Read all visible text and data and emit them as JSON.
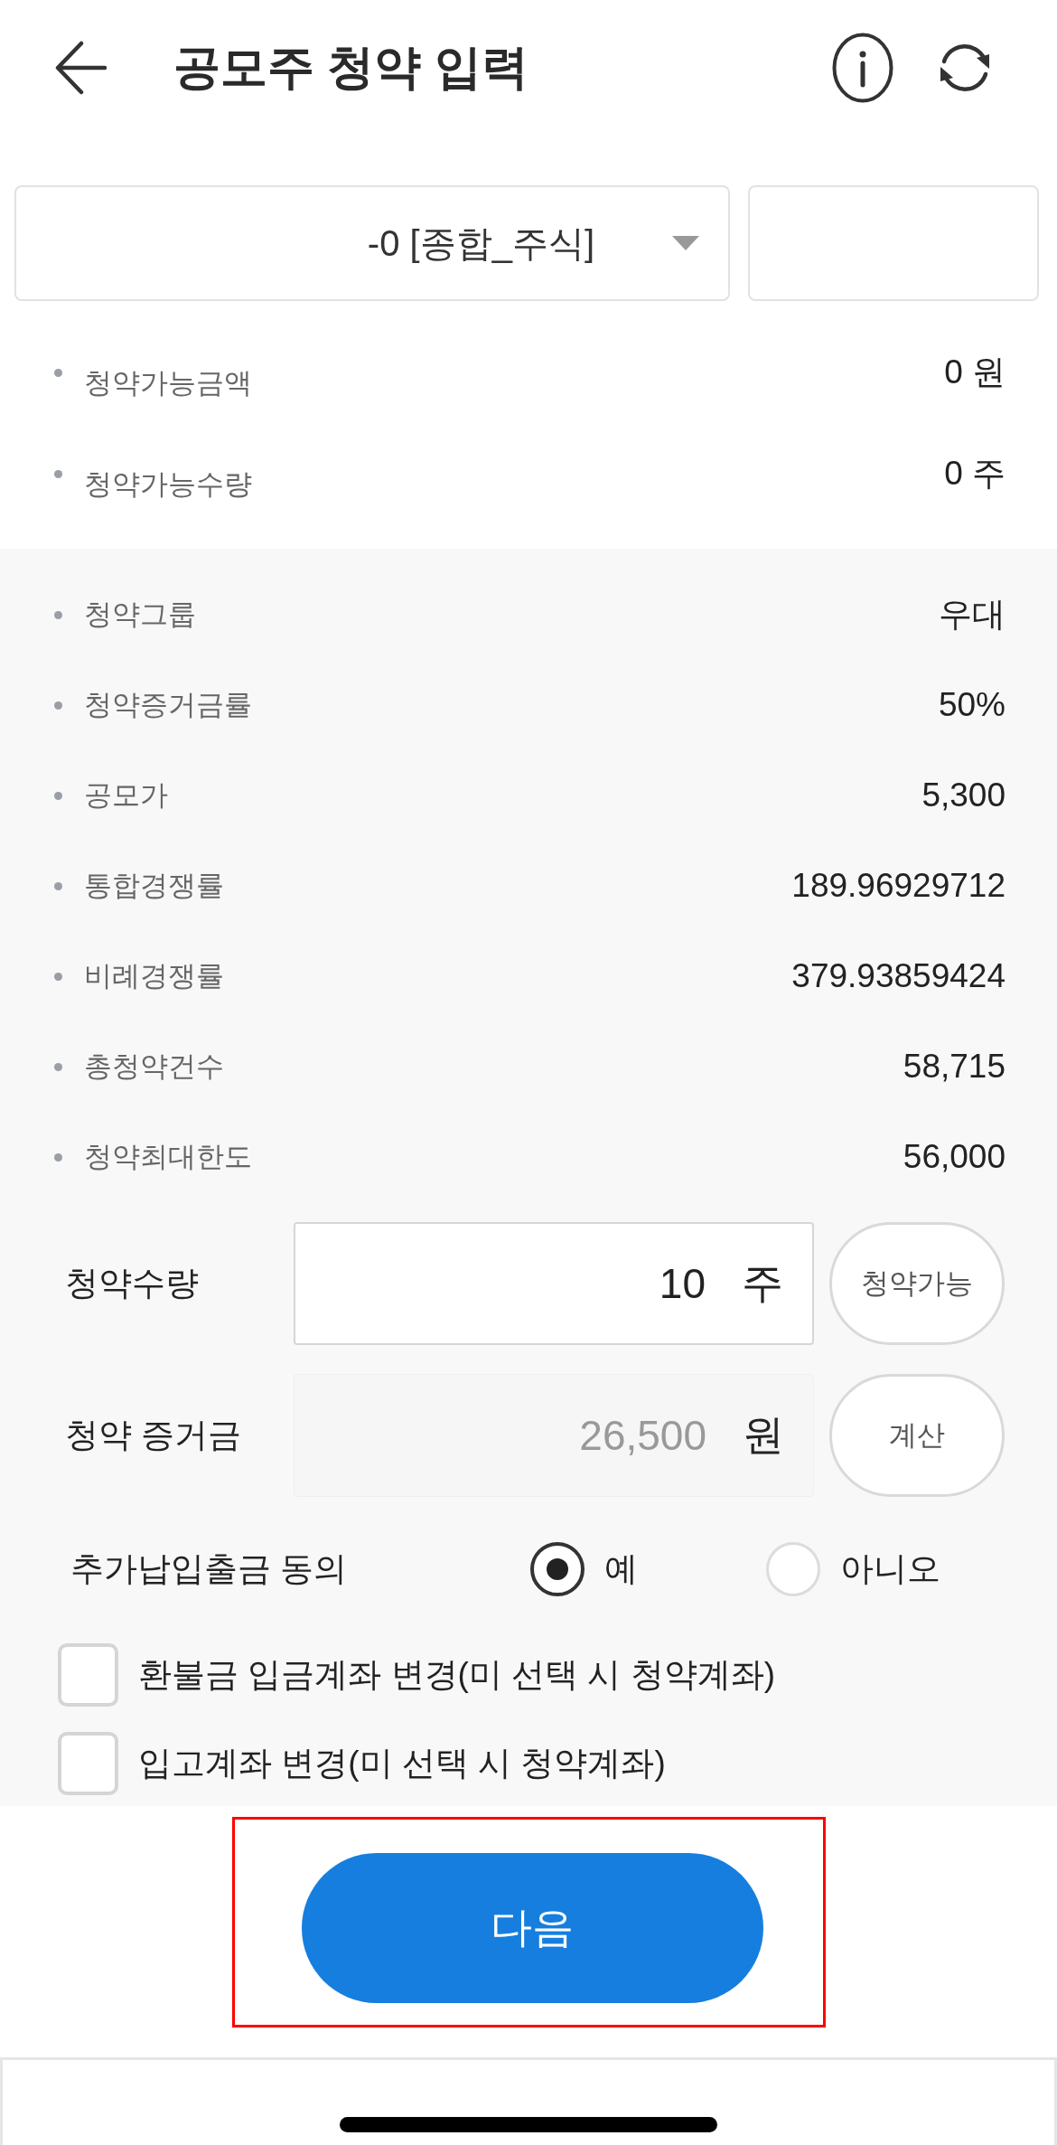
{
  "header": {
    "title": "공모주 청약 입력"
  },
  "account": {
    "value": "-0 [종합_주식]"
  },
  "balance": [
    {
      "label": "청약가능금액",
      "value": "0 원"
    },
    {
      "label": "청약가능수량",
      "value": "0 주"
    }
  ],
  "details": [
    {
      "label": "청약그룹",
      "value": "우대"
    },
    {
      "label": "청약증거금률",
      "value": "50%"
    },
    {
      "label": "공모가",
      "value": "5,300"
    },
    {
      "label": "통합경쟁률",
      "value": "189.96929712"
    },
    {
      "label": "비례경쟁률",
      "value": "379.93859424"
    },
    {
      "label": "총청약건수",
      "value": "58,715"
    },
    {
      "label": "청약최대한도",
      "value": "56,000"
    }
  ],
  "inputs": [
    {
      "label": "청약수량",
      "value": "10",
      "unit": "주",
      "button": "청약가능",
      "disabled": false
    },
    {
      "label": "청약 증거금",
      "value": "26,500",
      "unit": "원",
      "button": "계산",
      "disabled": true
    }
  ],
  "consent": {
    "label": "추가납입출금 동의",
    "options": [
      {
        "label": "예",
        "selected": true
      },
      {
        "label": "아니오",
        "selected": false
      }
    ]
  },
  "checkboxes": [
    {
      "label": "환불금 입금계좌 변경(미 선택 시 청약계좌)",
      "checked": false
    },
    {
      "label": "입고계좌 변경(미 선택 시 청약계좌)",
      "checked": false
    }
  ],
  "next_button": {
    "label": "다음",
    "highlighted": true
  }
}
